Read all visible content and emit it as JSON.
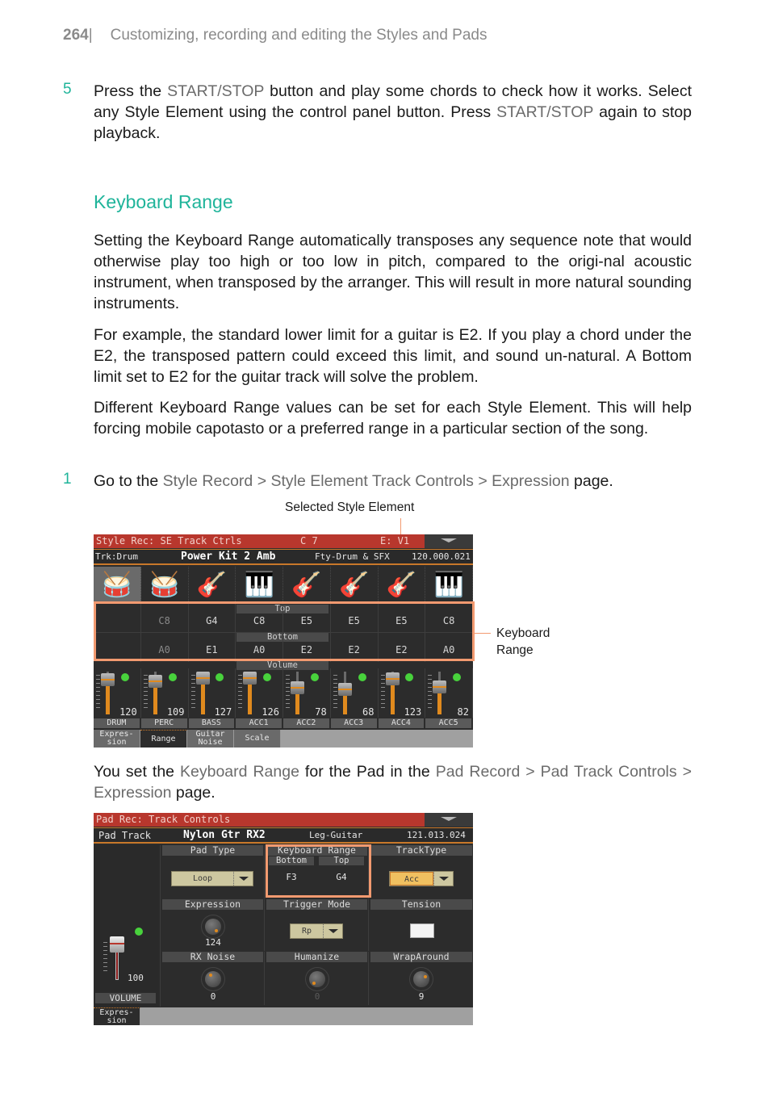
{
  "header": {
    "page_number": "264",
    "separator": "|",
    "chapter_title": "Customizing, recording and editing the Styles and Pads"
  },
  "step5": {
    "number": "5",
    "parts": [
      "Press the ",
      "START/STOP",
      " button and play some chords to check how it works. Select any Style Element using the control panel button. Press ",
      "START/STOP",
      " again to stop playback."
    ]
  },
  "section": {
    "heading": "Keyboard Range",
    "paragraphs": [
      "Setting the Keyboard Range automatically transposes any sequence note that would otherwise play too high or too low in pitch, compared to the origi-nal acoustic instrument, when transposed by the arranger. This will result in more natural sounding instruments.",
      "For example, the standard lower limit for a guitar is E2. If you play a chord under the E2, the transposed pattern could exceed this limit, and sound un-natural. A Bottom limit set to E2 for the guitar track will solve the problem.",
      "Different Keyboard Range values can be set for each Style Element. This will help forcing mobile capotasto or a preferred range in a particular section of the song."
    ]
  },
  "step1": {
    "number": "1",
    "parts": [
      "Go to the ",
      "Style Record > Style Element Track Controls > Expression",
      " page."
    ]
  },
  "callouts": {
    "selected_style_element": "Selected Style Element",
    "keyboard_range_1": "Keyboard",
    "keyboard_range_2": "Range"
  },
  "screen1": {
    "title": "Style Rec: SE Track Ctrls",
    "chord": "C 7",
    "element": "E: V1",
    "track_label": "Trk:Drum",
    "sound_name": "Power Kit 2 Amb",
    "category": "Fty-Drum & SFX",
    "program": "120.000.021",
    "instrument_icons": [
      "drums-icon",
      "drums-icon",
      "electric-guitar-icon",
      "keyboard-stand-icon",
      "acoustic-guitar-icon",
      "acoustic-guitar-icon",
      "acoustic-guitar-icon",
      "organ-icon"
    ],
    "top_label": "Top",
    "bottom_label": "Bottom",
    "volume_label": "Volume",
    "top_values": [
      "",
      "C8",
      "G4",
      "C8",
      "E5",
      "E5",
      "E5",
      "C8"
    ],
    "bottom_values": [
      "",
      "A0",
      "E1",
      "A0",
      "E2",
      "E2",
      "E2",
      "A0"
    ],
    "channels": [
      {
        "name": "DRUM",
        "volume": "120"
      },
      {
        "name": "PERC",
        "volume": "109"
      },
      {
        "name": "BASS",
        "volume": "127"
      },
      {
        "name": "ACC1",
        "volume": "126"
      },
      {
        "name": "ACC2",
        "volume": "78"
      },
      {
        "name": "ACC3",
        "volume": "68"
      },
      {
        "name": "ACC4",
        "volume": "123"
      },
      {
        "name": "ACC5",
        "volume": "82"
      }
    ],
    "tabs": [
      "Expres-\nsion",
      "Range",
      "Guitar\nNoise",
      "Scale"
    ],
    "active_tab": "Range"
  },
  "para_pad": {
    "parts": [
      "You set the ",
      "Keyboard Range",
      " for the Pad in the ",
      "Pad Record > Pad Track Controls > Expression",
      " page."
    ]
  },
  "screen2": {
    "title": "Pad Rec: Track Controls",
    "track_label": "Pad Track",
    "sound_name": "Nylon Gtr RX2",
    "category": "Leg-Guitar",
    "program": "121.013.024",
    "pad_type": {
      "label": "Pad Type",
      "value": "Loop"
    },
    "keyboard_range": {
      "label": "Keyboard Range",
      "bottom_label": "Bottom",
      "top_label": "Top",
      "bottom": "F3",
      "top": "G4"
    },
    "track_type": {
      "label": "TrackType",
      "value": "Acc"
    },
    "expression": {
      "label": "Expression",
      "value": "124"
    },
    "trigger_mode": {
      "label": "Trigger Mode",
      "value": "Rp"
    },
    "tension": {
      "label": "Tension",
      "checked": false
    },
    "rx_noise": {
      "label": "RX Noise",
      "value": "0"
    },
    "humanize": {
      "label": "Humanize",
      "value": "0"
    },
    "wrap_around": {
      "label": "WrapAround",
      "value": "9"
    },
    "volume": {
      "label": "VOLUME",
      "value": "100"
    },
    "tabs": [
      "Expres-\nsion"
    ]
  },
  "colors": {
    "accent_teal": "#1fb49a",
    "callout_orange": "#f29a70",
    "titlebar_red": "#b8372d",
    "fader_orange": "#e08a1e",
    "led_green": "#48d23c"
  }
}
